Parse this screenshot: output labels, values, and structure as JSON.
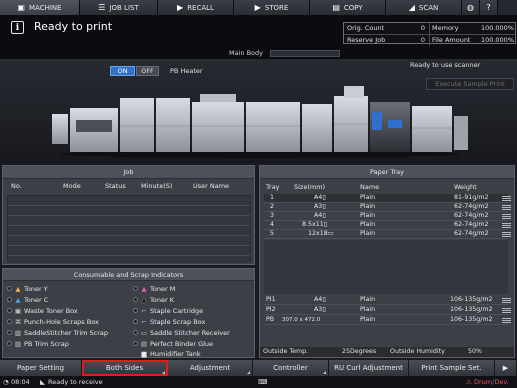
{
  "tabs": [
    {
      "label": "MACHINE",
      "icon": "machine-icon"
    },
    {
      "label": "JOB LIST",
      "icon": "job-list-icon"
    },
    {
      "label": "RECALL",
      "icon": "recall-icon"
    },
    {
      "label": "STORE",
      "icon": "store-icon"
    },
    {
      "label": "COPY",
      "icon": "copy-icon"
    },
    {
      "label": "SCAN",
      "icon": "scan-icon"
    }
  ],
  "header": {
    "status": "Ready to print",
    "main_body_label": "Main Body",
    "orig_count_label": "Orig. Count",
    "orig_count": "0",
    "memory_label": "Memory",
    "memory": "100.000%",
    "reserve_job_label": "Reserve Job",
    "reserve_job": "0",
    "file_amount_label": "File Amount",
    "file_amount": "100.000%",
    "scanner_msg": "Ready to use scanner",
    "execute_sample": "Execute Sample Print"
  },
  "pb_heater": {
    "on": "ON",
    "off": "OFF",
    "label": "PB Heater"
  },
  "job_panel": {
    "title": "Job",
    "columns": [
      "No.",
      "Mode",
      "Status",
      "Minute(S)",
      "User Name"
    ]
  },
  "paper_tray": {
    "title": "Paper Tray",
    "columns": [
      "Tray",
      "Size(mm)",
      "Name",
      "Weight"
    ],
    "rows": [
      {
        "tray": "1",
        "size": "A4▯",
        "name": "Plain",
        "weight": "81-91g/m2"
      },
      {
        "tray": "2",
        "size": "A3▯",
        "name": "Plain",
        "weight": "62-74g/m2"
      },
      {
        "tray": "3",
        "size": "A4▯",
        "name": "Plain",
        "weight": "62-74g/m2"
      },
      {
        "tray": "4",
        "size": "8.5x11▯",
        "name": "Plain",
        "weight": "62-74g/m2"
      },
      {
        "tray": "5",
        "size": "12x18▭",
        "name": "Plain",
        "weight": "62-74g/m2"
      },
      {
        "tray": "PI1",
        "size": "A4▯",
        "name": "Plain",
        "weight": "106-135g/m2"
      },
      {
        "tray": "PI2",
        "size": "A3▯",
        "name": "Plain",
        "weight": "106-135g/m2"
      },
      {
        "tray": "PB",
        "size": "307.0 x 472.0",
        "name": "Plain",
        "weight": "106-135g/m2"
      }
    ],
    "outside_temp_label": "Outside Temp.",
    "outside_temp": "25Degrees",
    "outside_humidity_label": "Outside Humidity",
    "outside_humidity": "50%"
  },
  "scrap_panel": {
    "title": "Consumable and Scrap Indicators",
    "left": [
      "Toner Y",
      "Toner C",
      "Waste Toner Box",
      "Punch-Hole Scraps Box",
      "SaddleStitcher Trim Scrap",
      "PB Trim Scrap"
    ],
    "right": [
      "Toner M",
      "Toner K",
      "Staple Cartridge",
      "Staple Scrap Box",
      "Saddle Stitcher Receiver",
      "Perfect Binder Glue",
      "Humidifier Tank"
    ]
  },
  "bottom_buttons": [
    {
      "label": "Paper Setting"
    },
    {
      "label": "Both Sides"
    },
    {
      "label": "Adjustment"
    },
    {
      "label": "Controller"
    },
    {
      "label": "RU Curl Adjustment"
    },
    {
      "label": "Print Sample Set."
    }
  ],
  "statusbar": {
    "time": "08:04",
    "message": "Ready to receive",
    "user": "Drum/Dev."
  }
}
